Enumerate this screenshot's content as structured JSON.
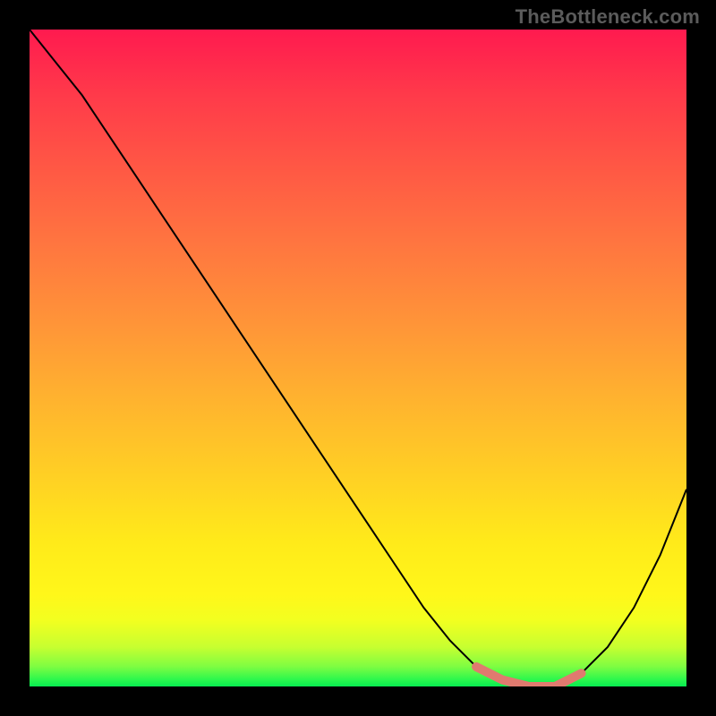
{
  "watermark": "TheBottleneck.com",
  "colors": {
    "curve": "#000000",
    "highlight": "#e07a6f",
    "background_top": "#ff1a4f",
    "background_bottom": "#07ec51",
    "frame": "#000000"
  },
  "chart_data": {
    "type": "line",
    "title": "",
    "xlabel": "",
    "ylabel": "",
    "xlim": [
      0,
      100
    ],
    "ylim": [
      0,
      100
    ],
    "grid": false,
    "legend": false,
    "series": [
      {
        "name": "bottleneck_curve",
        "x": [
          0,
          4,
          8,
          12,
          16,
          20,
          24,
          28,
          32,
          36,
          40,
          44,
          48,
          52,
          56,
          60,
          64,
          68,
          72,
          76,
          80,
          84,
          88,
          92,
          96,
          100
        ],
        "y": [
          100,
          95,
          90,
          84,
          78,
          72,
          66,
          60,
          54,
          48,
          42,
          36,
          30,
          24,
          18,
          12,
          7,
          3,
          1,
          0,
          0,
          2,
          6,
          12,
          20,
          30
        ]
      },
      {
        "name": "highlight_region",
        "x": [
          68,
          72,
          76,
          80,
          84
        ],
        "y": [
          3,
          1,
          0,
          0,
          2
        ]
      }
    ],
    "annotations": []
  }
}
